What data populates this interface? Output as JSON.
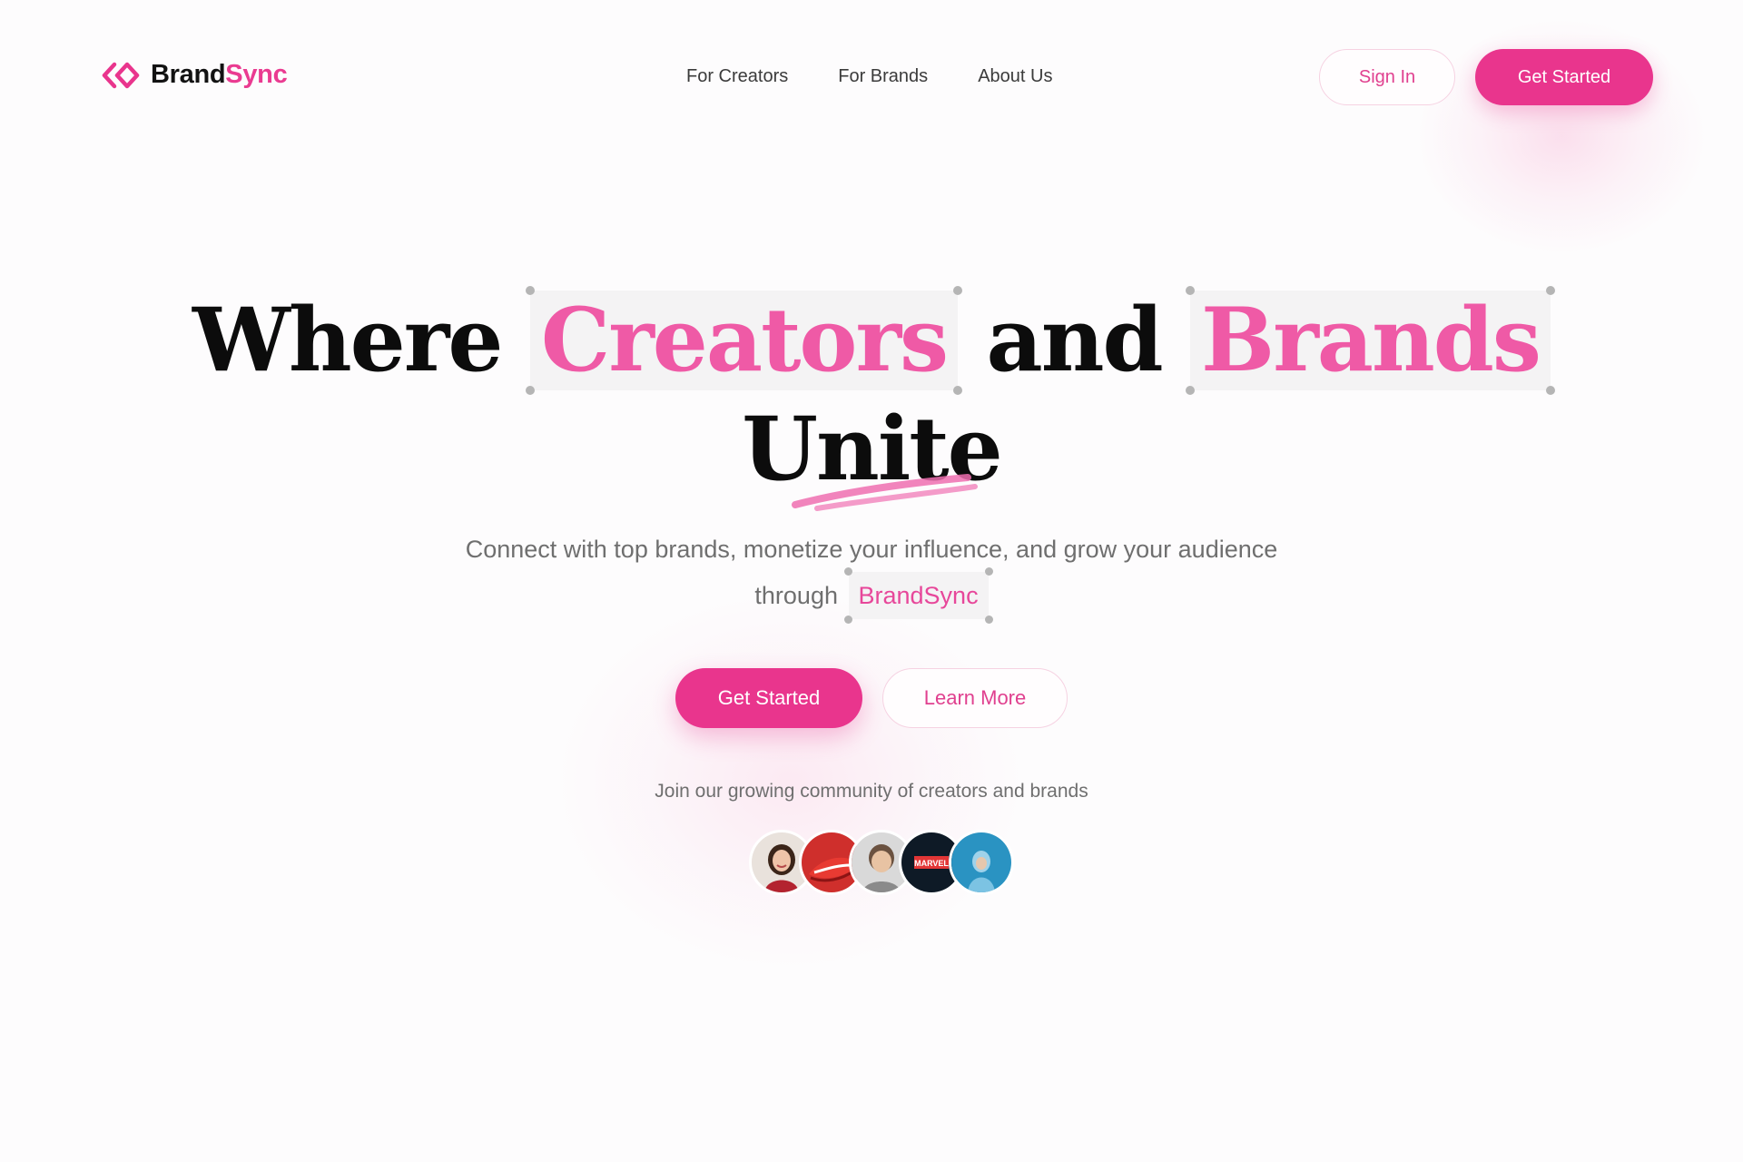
{
  "brand": {
    "name_part1": "Brand",
    "name_part2": "Sync",
    "icon": "diamond-chevrons-icon"
  },
  "nav": {
    "items": [
      {
        "label": "For Creators"
      },
      {
        "label": "For Brands"
      },
      {
        "label": "About Us"
      }
    ]
  },
  "header": {
    "sign_in_label": "Sign In",
    "get_started_label": "Get Started"
  },
  "hero": {
    "title_word1": "Where",
    "title_highlight1": "Creators",
    "title_word2": "and",
    "title_highlight2": "Brands",
    "title_line2": "Unite",
    "subtitle_line1": "Connect with top brands, monetize your influence, and grow your audience",
    "subtitle_line2_prefix": "through",
    "subtitle_highlight": "BrandSync",
    "primary_cta": "Get Started",
    "secondary_cta": "Learn More"
  },
  "community": {
    "text": "Join our growing community of creators and brands",
    "avatars": [
      {
        "name": "creator-woman-avatar"
      },
      {
        "name": "red-sneaker-avatar"
      },
      {
        "name": "creator-man-avatar"
      },
      {
        "name": "marvel-logo-avatar",
        "label": "MARVEL"
      },
      {
        "name": "hooded-person-avatar"
      }
    ]
  },
  "colors": {
    "accent": "#e9358d",
    "highlight_text": "#ef5aa6",
    "text_dark": "#0c0c0c",
    "text_muted": "#6f6f6f"
  }
}
